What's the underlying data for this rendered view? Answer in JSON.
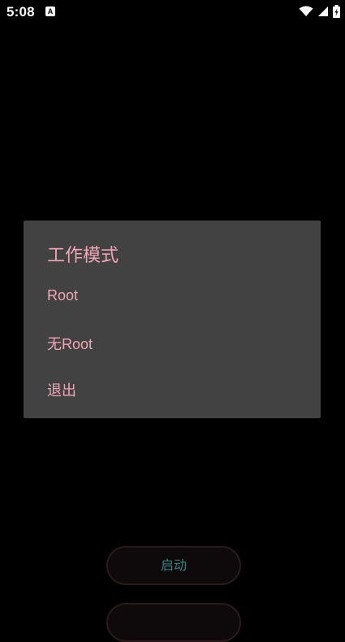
{
  "status_bar": {
    "time": "5:08",
    "app_icon_letter": "A",
    "icons": [
      "wifi-icon",
      "signal-icon",
      "battery-charging-icon"
    ]
  },
  "dialog": {
    "title": "工作模式",
    "options": [
      {
        "label": "Root"
      },
      {
        "label": "无Root"
      },
      {
        "label": "退出"
      }
    ]
  },
  "buttons": {
    "start_label": "启动"
  },
  "colors": {
    "dialog_bg": "#424242",
    "accent_pink": "#f0a6b8",
    "button_text": "#3b7f80",
    "background": "#000000"
  }
}
